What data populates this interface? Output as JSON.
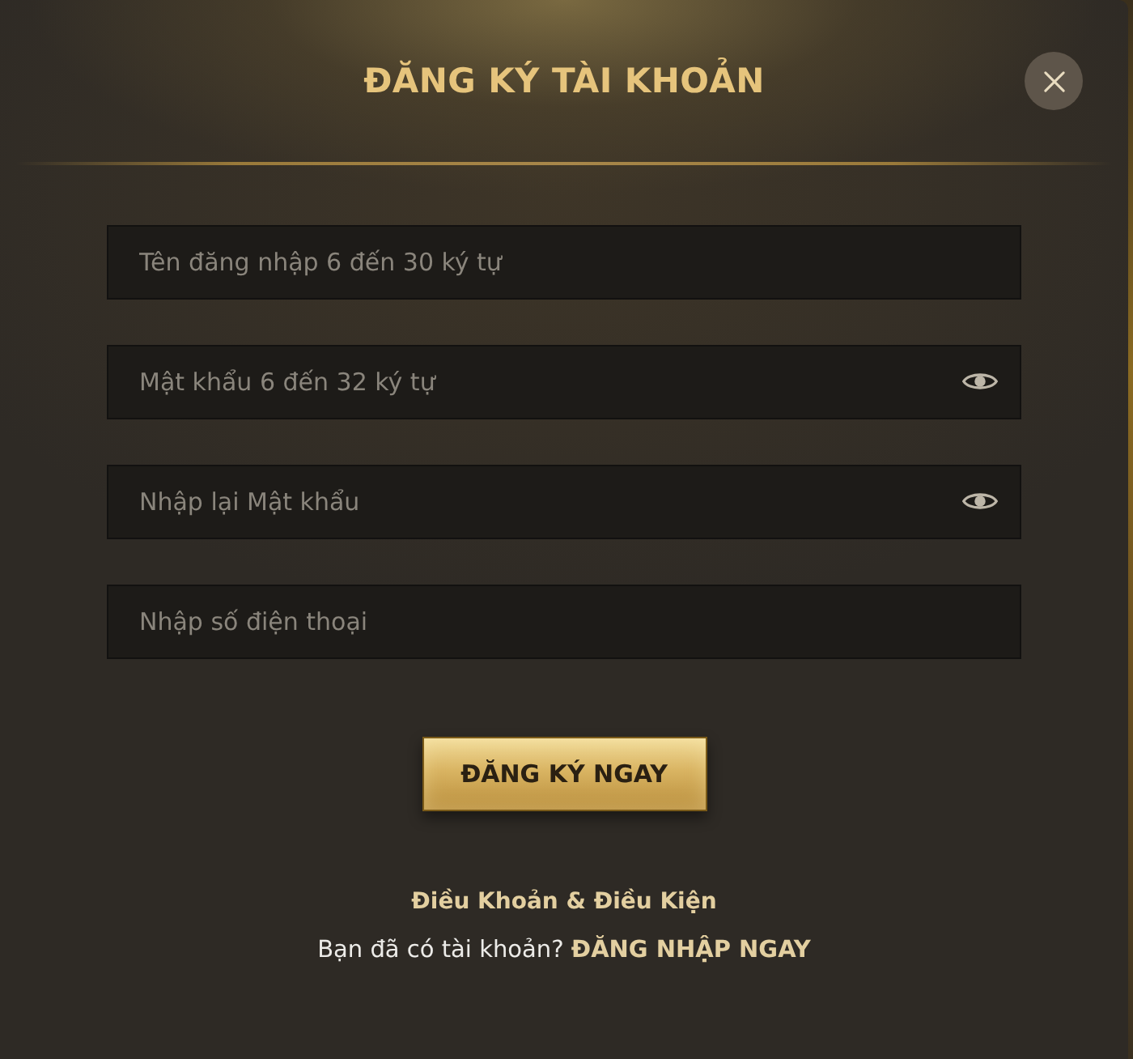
{
  "dialog": {
    "title": "ĐĂNG KÝ TÀI KHOẢN"
  },
  "fields": [
    {
      "kind": "text",
      "placeholder": "Tên đăng nhập 6 đến 30 ký tự"
    },
    {
      "kind": "password",
      "placeholder": "Mật khẩu 6 đến 32 ký tự"
    },
    {
      "kind": "password",
      "placeholder": "Nhập lại Mật khẩu"
    },
    {
      "kind": "text",
      "placeholder": "Nhập số điện thoại"
    }
  ],
  "submit_button": {
    "label": "ĐĂNG KÝ NGAY"
  },
  "terms_link": {
    "label": "Điều Khoản & Điều Kiện"
  },
  "login_prompt": {
    "text": "Bạn đã có tài khoản?",
    "link": "ĐĂNG NHẬP NGAY"
  }
}
